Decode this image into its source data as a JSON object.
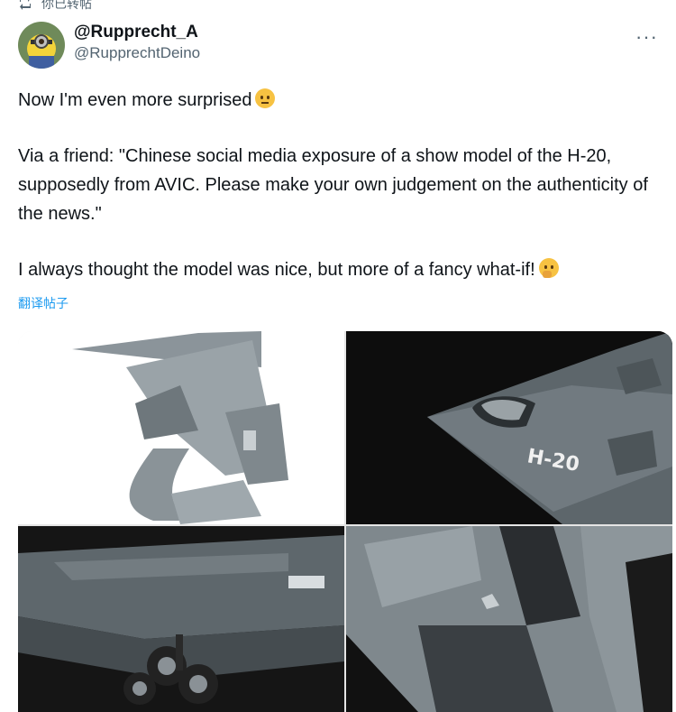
{
  "retweet": {
    "text": "你已转帖"
  },
  "author": {
    "display_name": "@Rupprecht_A",
    "handle": "@RupprechtDeino"
  },
  "more_label": "···",
  "tweet": {
    "line1": "Now I'm even more surprised",
    "line2": "Via a friend: \"Chinese social media exposure of a show model of the H-20, supposedly from AVIC. Please make your own judgement on the authenticity of the news.\"",
    "line3": "I always thought the model was nice, but more of a fancy what-if!"
  },
  "translate_label": "翻译帖子",
  "media": {
    "model_label": "H-20"
  },
  "icons": {
    "retweet": "retweet-icon",
    "avatar": "minion-avatar",
    "emoji1": "raised-eyebrow-emoji",
    "emoji2": "thinking-emoji"
  }
}
